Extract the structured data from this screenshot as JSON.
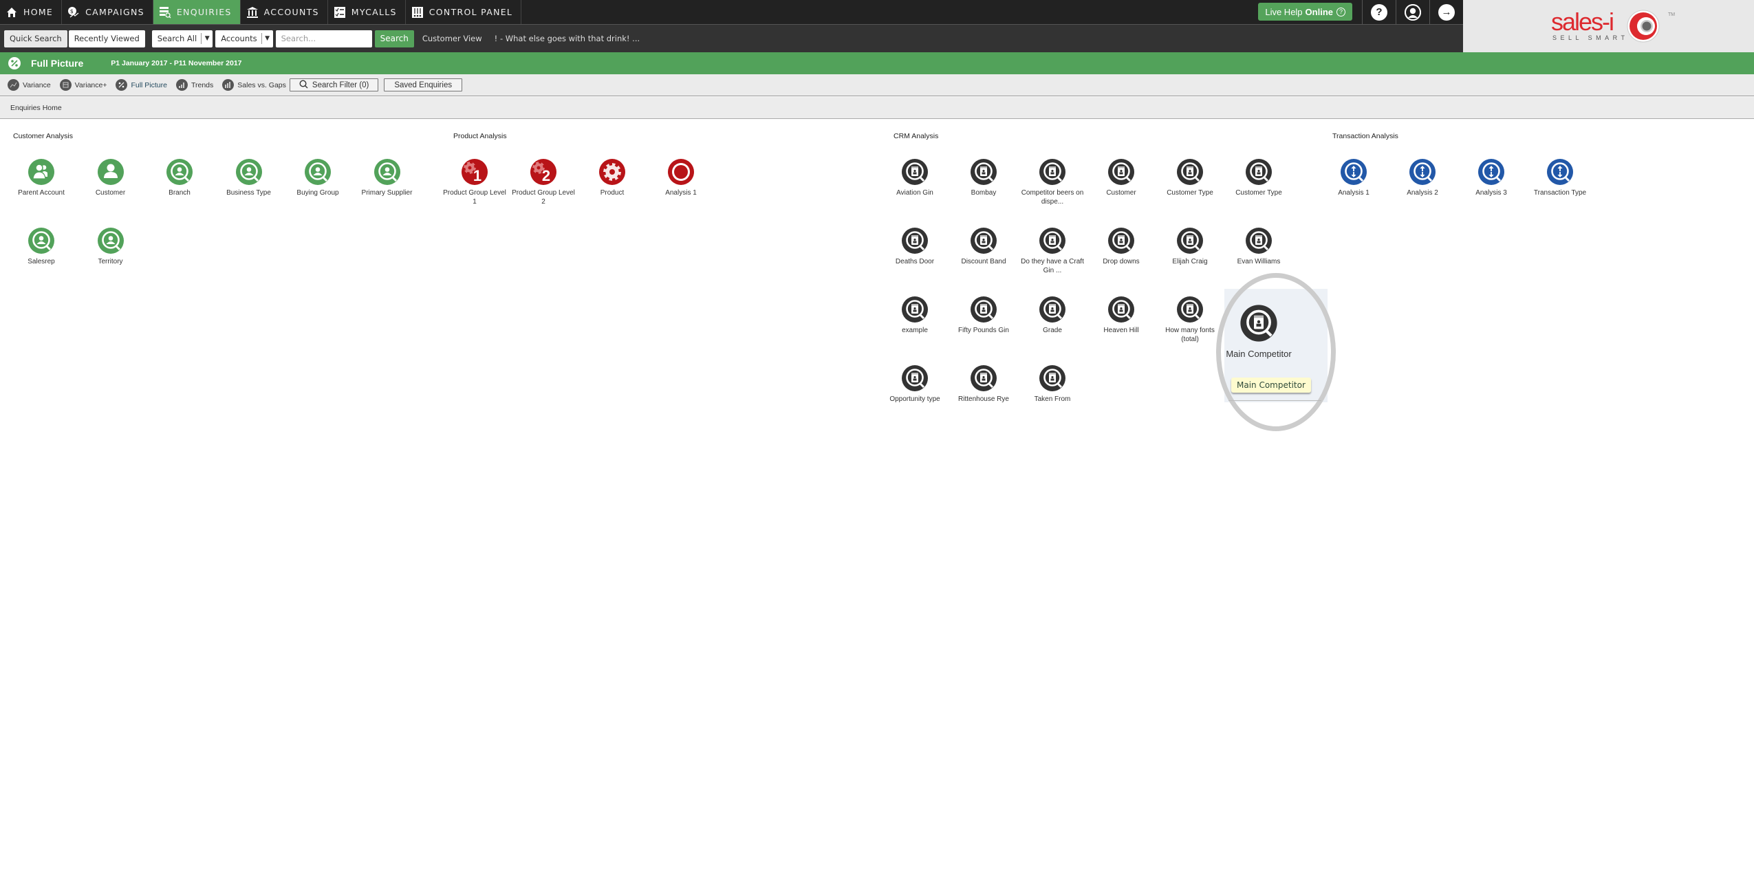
{
  "nav": {
    "items": [
      {
        "label": "HOME",
        "icon": "home-icon"
      },
      {
        "label": "CAMPAIGNS",
        "icon": "campaigns-icon"
      },
      {
        "label": "ENQUIRIES",
        "icon": "enquiries-icon",
        "active": true
      },
      {
        "label": "ACCOUNTS",
        "icon": "accounts-icon"
      },
      {
        "label": "MYCALLS",
        "icon": "mycalls-icon"
      },
      {
        "label": "CONTROL PANEL",
        "icon": "control-panel-icon"
      }
    ],
    "live_help": {
      "prefix": "Live Help",
      "status": "Online",
      "q": "?"
    },
    "help_glyph": "?",
    "logout_glyph": "→"
  },
  "subbar": {
    "quick_search": "Quick Search",
    "recently_viewed": "Recently Viewed",
    "scope_select": "Search All",
    "type_select": "Accounts",
    "search_placeholder": "Search...",
    "search_value": "",
    "search_button": "Search",
    "customer_view": "Customer View",
    "recent_link": "! - What else goes with that drink! ..."
  },
  "logo": {
    "text": "sales-i",
    "tagline": "SELL SMART",
    "tm": "TM"
  },
  "title": {
    "page_title": "Full Picture",
    "date_range": "P1 January 2017 - P11 November 2017"
  },
  "tools": {
    "items": [
      {
        "label": "Variance",
        "icon": "variance-icon"
      },
      {
        "label": "Variance+",
        "icon": "variance-plus-icon"
      },
      {
        "label": "Full Picture",
        "icon": "full-picture-icon",
        "active": true
      },
      {
        "label": "Trends",
        "icon": "trends-icon"
      },
      {
        "label": "Sales vs. Gaps",
        "icon": "sales-vs-gaps-icon"
      }
    ],
    "search_filter": "Search Filter (0)",
    "saved_enquiries": "Saved Enquiries"
  },
  "breadcrumb": "Enquiries Home",
  "colors": {
    "green": "#52a25a",
    "red": "#b81418",
    "dark": "#333333",
    "blue": "#2258a8"
  },
  "sections": [
    {
      "title": "Customer Analysis",
      "items": [
        {
          "label": "Parent Account",
          "icon": "parent-account-icon"
        },
        {
          "label": "Customer",
          "icon": "customer-icon"
        },
        {
          "label": "Branch",
          "icon": "search-person-icon"
        },
        {
          "label": "Business Type",
          "icon": "search-person-icon"
        },
        {
          "label": "Buying Group",
          "icon": "search-person-icon"
        },
        {
          "label": "Primary Supplier",
          "icon": "search-person-icon"
        },
        {
          "label": "Salesrep",
          "icon": "search-person-icon"
        },
        {
          "label": "Territory",
          "icon": "search-person-icon"
        }
      ]
    },
    {
      "title": "Product Analysis",
      "items": [
        {
          "label": "Product Group Level 1",
          "icon": "product-group-1-icon",
          "badge": "1"
        },
        {
          "label": "Product Group Level 2",
          "icon": "product-group-2-icon",
          "badge": "2"
        },
        {
          "label": "Product",
          "icon": "gear-icon"
        },
        {
          "label": "Analysis 1",
          "icon": "target-icon"
        }
      ]
    },
    {
      "title": "CRM Analysis",
      "items": [
        {
          "label": "Aviation Gin"
        },
        {
          "label": "Bombay"
        },
        {
          "label": "Competitor beers on dispe..."
        },
        {
          "label": "Customer"
        },
        {
          "label": "Customer Type"
        },
        {
          "label": "Customer Type"
        },
        {
          "label": "Deaths Door"
        },
        {
          "label": "Discount Band"
        },
        {
          "label": "Do they have a Craft Gin ..."
        },
        {
          "label": "Drop downs"
        },
        {
          "label": "Elijah Craig"
        },
        {
          "label": "Evan Williams"
        },
        {
          "label": "example"
        },
        {
          "label": "Fifty Pounds Gin"
        },
        {
          "label": "Grade"
        },
        {
          "label": "Heaven Hill"
        },
        {
          "label": "How many fonts (total)"
        },
        {
          "label": "Main Competitor",
          "hovered": true
        },
        {
          "label": "Opportunity type"
        },
        {
          "label": "Rittenhouse Rye"
        },
        {
          "label": "Taken From"
        }
      ]
    },
    {
      "title": "Transaction Analysis",
      "items": [
        {
          "label": "Analysis 1"
        },
        {
          "label": "Analysis 2"
        },
        {
          "label": "Analysis 3"
        },
        {
          "label": "Transaction Type"
        }
      ]
    }
  ],
  "tooltip": "Main Competitor"
}
